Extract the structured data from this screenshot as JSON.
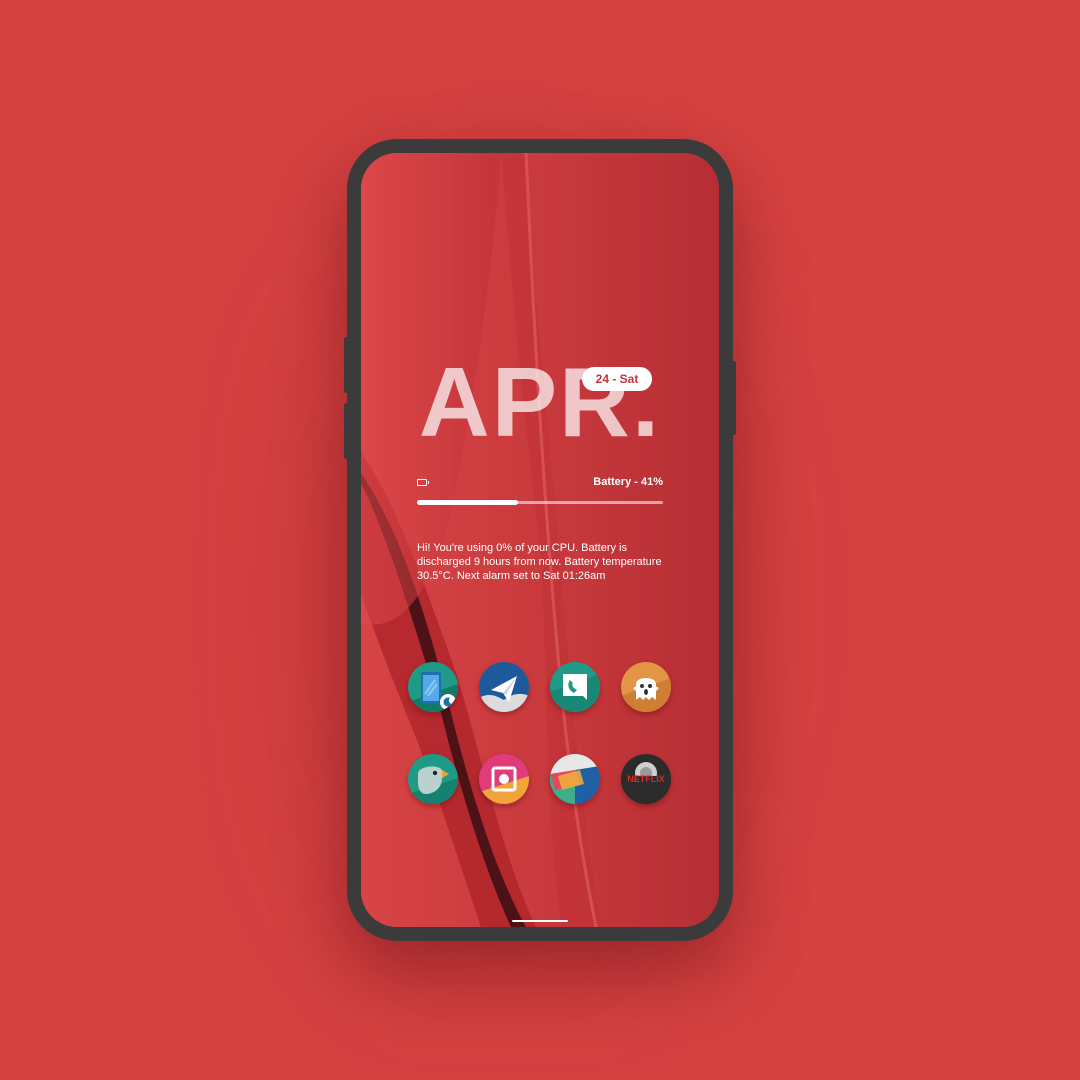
{
  "lockscreen": {
    "month": "APR.",
    "date_pill": "24 - Sat",
    "battery_label": "Battery - 41%",
    "battery_level": 0.41,
    "info_text": "Hi! You're using 0% of your CPU. Battery is discharged 9 hours from now. Battery temperature 30.5°C. Next alarm set to Sat 01:26am"
  },
  "icons": [
    {
      "name": "tablet-icon"
    },
    {
      "name": "paper-plane-icon"
    },
    {
      "name": "chat-bubble-icon"
    },
    {
      "name": "ghost-icon"
    },
    {
      "name": "bird-icon"
    },
    {
      "name": "camera-icon"
    },
    {
      "name": "folded-map-icon"
    },
    {
      "name": "netflix-icon",
      "label": "NETFLIX"
    }
  ],
  "colors": {
    "background": "#d64242",
    "phone_frame": "#3b3b3b",
    "accent_red": "#c0343a"
  }
}
